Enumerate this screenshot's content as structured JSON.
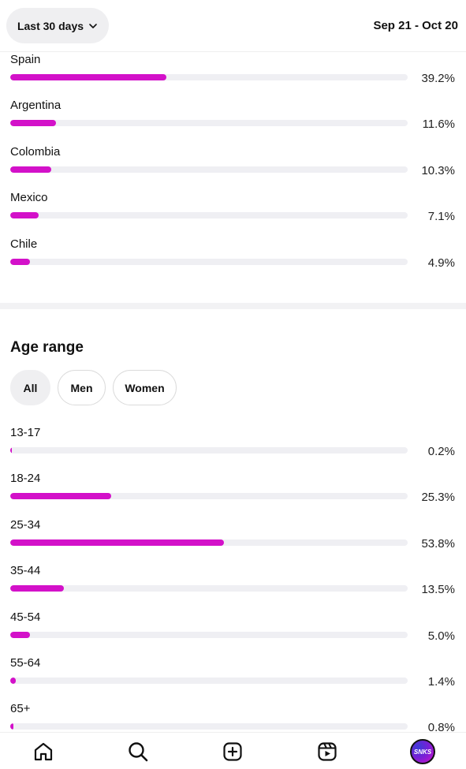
{
  "header": {
    "period_label": "Last 30 days",
    "date_range": "Sep 21 - Oct 20"
  },
  "locations": [
    {
      "label": "Spain",
      "value": "39.2%",
      "fraction": 0.392
    },
    {
      "label": "Argentina",
      "value": "11.6%",
      "fraction": 0.116
    },
    {
      "label": "Colombia",
      "value": "10.3%",
      "fraction": 0.103
    },
    {
      "label": "Mexico",
      "value": "7.1%",
      "fraction": 0.071
    },
    {
      "label": "Chile",
      "value": "4.9%",
      "fraction": 0.049
    }
  ],
  "age_range": {
    "title": "Age range",
    "filters": [
      {
        "label": "All",
        "selected": true
      },
      {
        "label": "Men",
        "selected": false
      },
      {
        "label": "Women",
        "selected": false
      }
    ],
    "rows": [
      {
        "label": "13-17",
        "value": "0.2%",
        "fraction": 0.002
      },
      {
        "label": "18-24",
        "value": "25.3%",
        "fraction": 0.253
      },
      {
        "label": "25-34",
        "value": "53.8%",
        "fraction": 0.538
      },
      {
        "label": "35-44",
        "value": "13.5%",
        "fraction": 0.135
      },
      {
        "label": "45-54",
        "value": "5.0%",
        "fraction": 0.05
      },
      {
        "label": "55-64",
        "value": "1.4%",
        "fraction": 0.014
      },
      {
        "label": "65+",
        "value": "0.8%",
        "fraction": 0.008
      }
    ]
  },
  "bar_color": "#d311c9",
  "avatar_text": "SNKS",
  "nav": [
    "home-icon",
    "search-icon",
    "create-icon",
    "reels-icon",
    "profile-avatar"
  ]
}
